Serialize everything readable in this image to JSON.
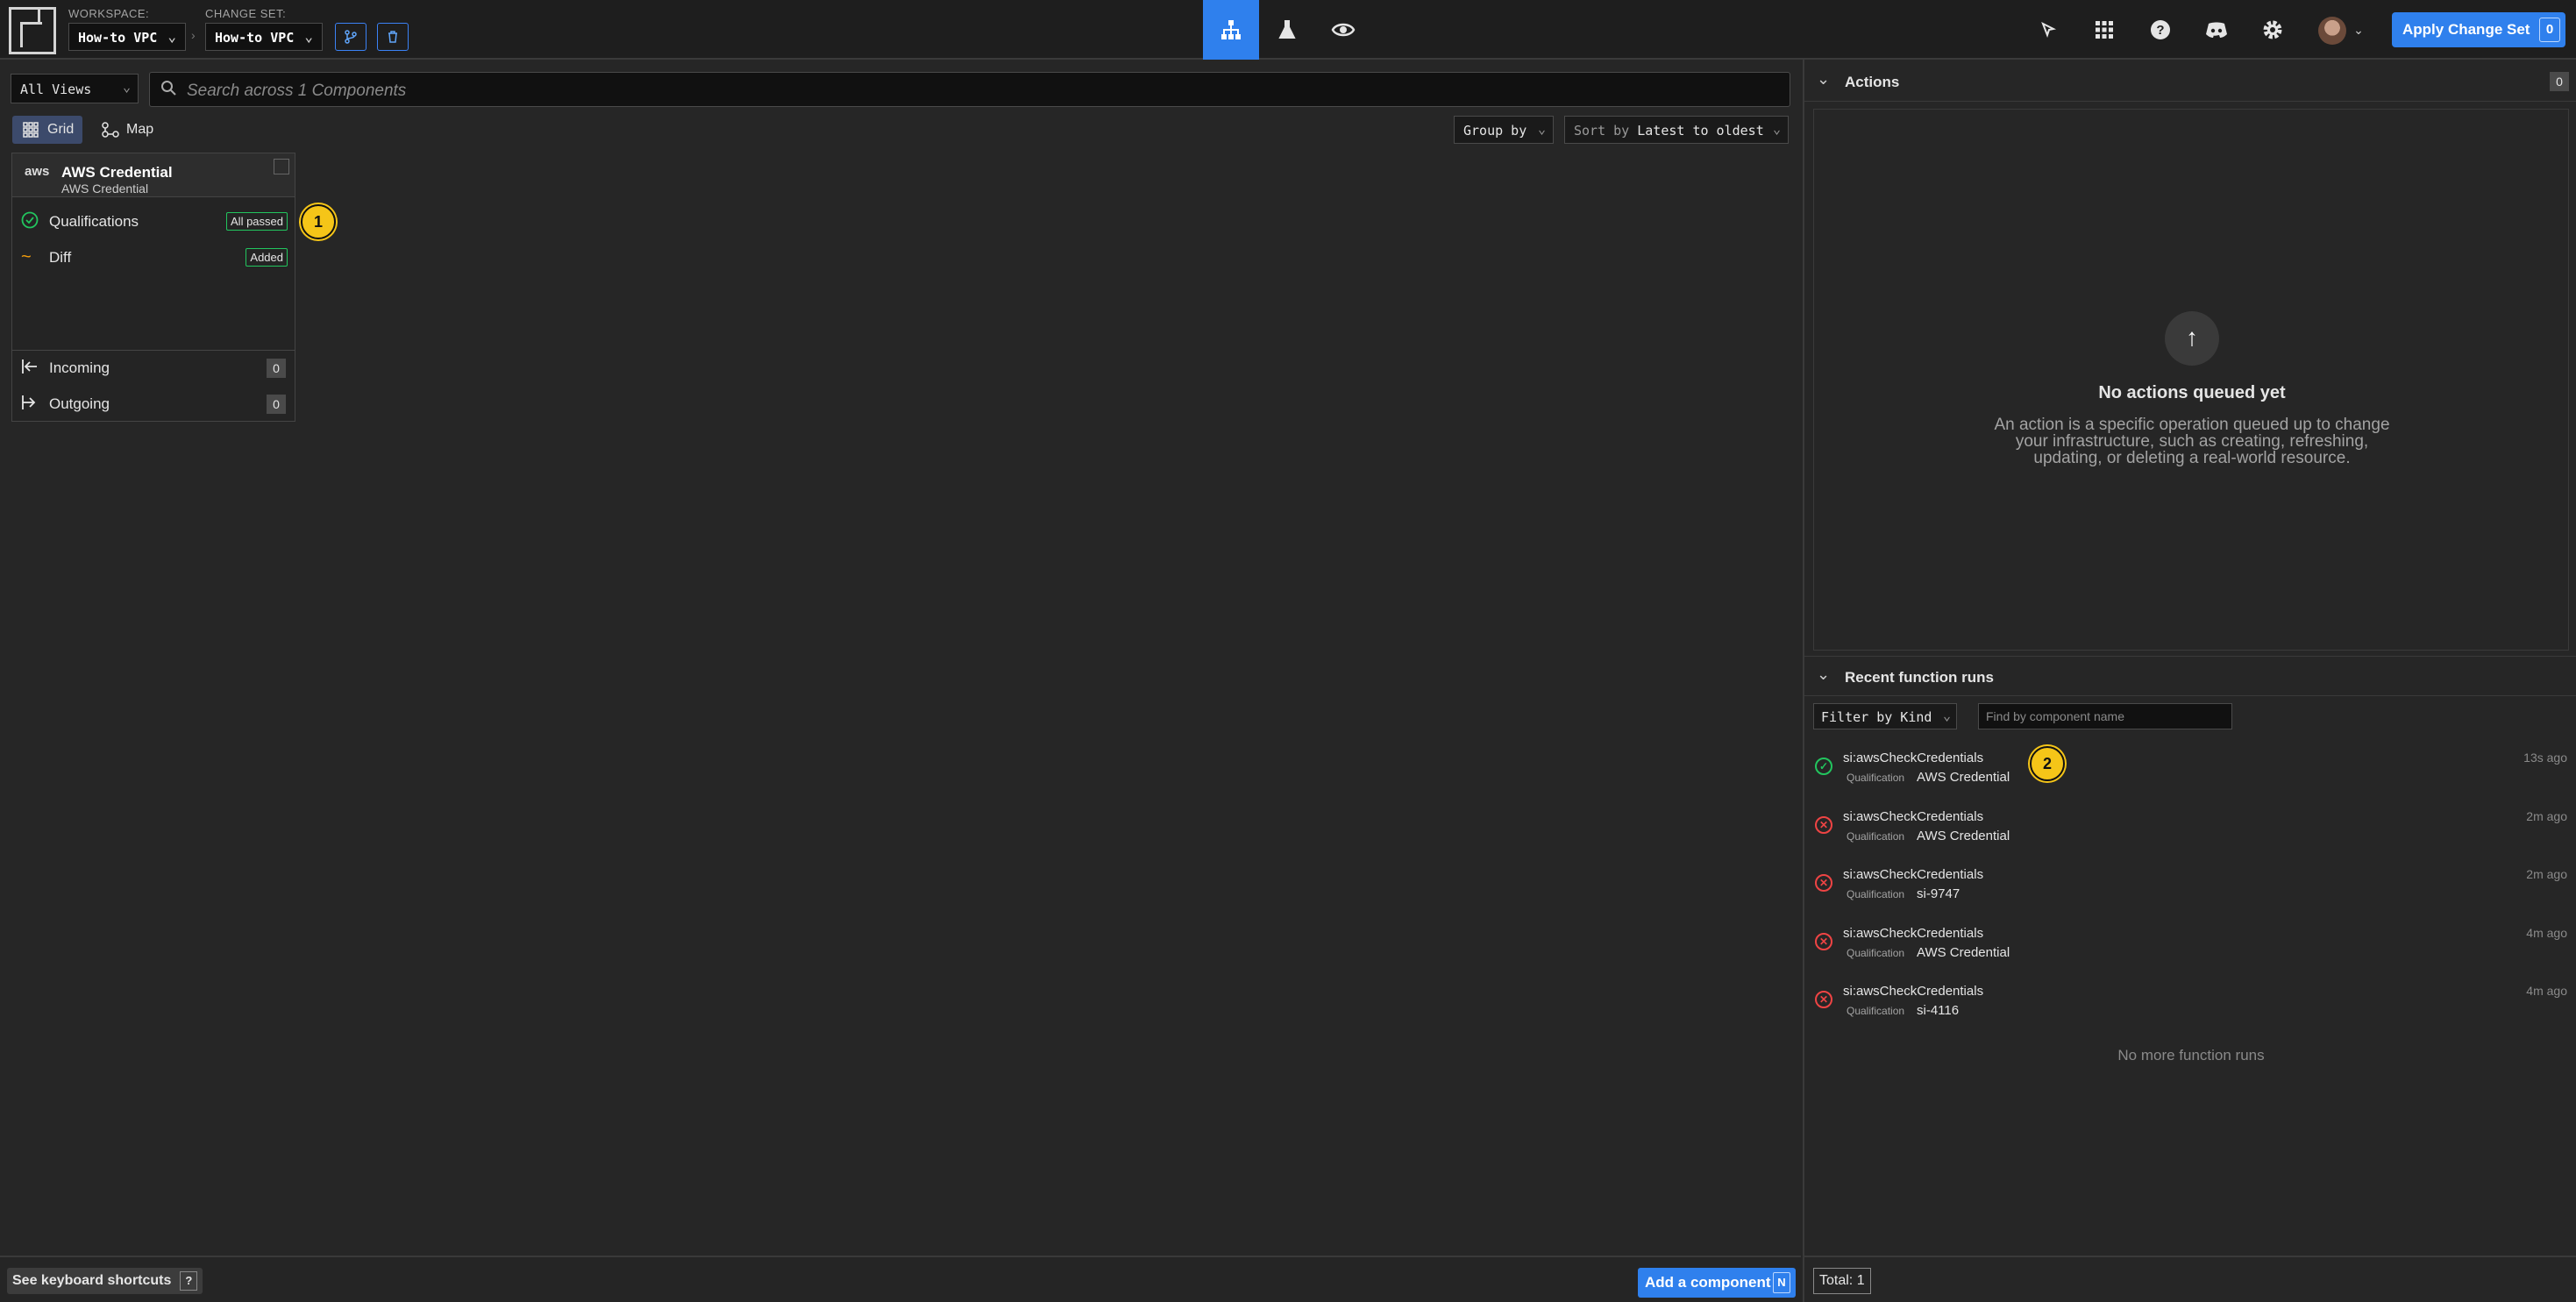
{
  "topbar": {
    "workspace_label": "WORKSPACE:",
    "workspace_value": "How-to VPC",
    "changeset_label": "CHANGE SET:",
    "changeset_value": "How-to VPC",
    "apply_label": "Apply Change Set",
    "apply_count": "0"
  },
  "toolbar": {
    "views_value": "All Views",
    "search_placeholder": "Search across 1 Components",
    "grid_label": "Grid",
    "map_label": "Map",
    "group_by_label": "Group by",
    "sort_by_label": "Sort by",
    "sort_by_value": "Latest to oldest"
  },
  "component_card": {
    "logo_text": "aws",
    "title": "AWS Credential",
    "subtitle": "AWS Credential",
    "qualifications_label": "Qualifications",
    "qualifications_badge": "All passed",
    "diff_label": "Diff",
    "diff_badge": "Added",
    "incoming_label": "Incoming",
    "incoming_count": "0",
    "outgoing_label": "Outgoing",
    "outgoing_count": "0"
  },
  "markers": [
    "1",
    "2"
  ],
  "bottom": {
    "shortcuts_label": "See keyboard shortcuts",
    "shortcuts_key": "?",
    "add_component_label": "Add a component",
    "add_component_key": "N"
  },
  "actions_panel": {
    "title": "Actions",
    "count": "0",
    "empty_title": "No actions queued yet",
    "empty_desc": "An action is a specific operation queued up to change your infrastructure, such as creating, refreshing, updating, or deleting a real-world resource."
  },
  "function_runs": {
    "title": "Recent function runs",
    "filter_label": "Filter by Kind",
    "find_placeholder": "Find by component name",
    "runs": [
      {
        "name": "si:awsCheckCredentials",
        "kind": "Qualification",
        "component": "AWS Credential",
        "ago": "13s ago",
        "status": "success"
      },
      {
        "name": "si:awsCheckCredentials",
        "kind": "Qualification",
        "component": "AWS Credential",
        "ago": "2m ago",
        "status": "failure"
      },
      {
        "name": "si:awsCheckCredentials",
        "kind": "Qualification",
        "component": "si-9747",
        "ago": "2m ago",
        "status": "failure"
      },
      {
        "name": "si:awsCheckCredentials",
        "kind": "Qualification",
        "component": "AWS Credential",
        "ago": "4m ago",
        "status": "failure"
      },
      {
        "name": "si:awsCheckCredentials",
        "kind": "Qualification",
        "component": "si-4116",
        "ago": "4m ago",
        "status": "failure"
      }
    ],
    "no_more": "No more function runs",
    "total": "Total: 1"
  },
  "colors": {
    "accent": "#2f80ed",
    "success": "#22c55e",
    "failure": "#ef4444",
    "marker": "#f5c518"
  }
}
